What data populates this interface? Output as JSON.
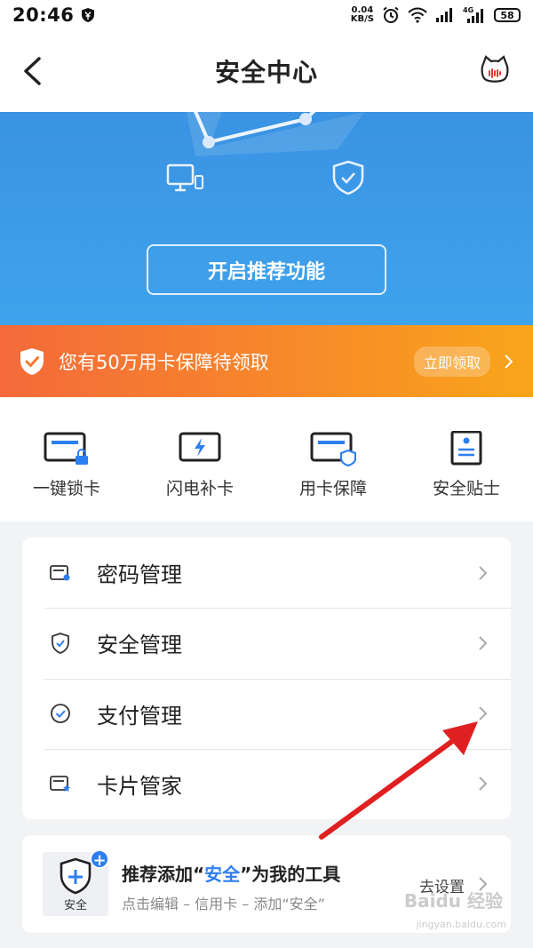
{
  "status_bar": {
    "time": "20:46",
    "net_speed_value": "0.04",
    "net_speed_unit": "KB/S",
    "network": "4G",
    "battery": "58"
  },
  "nav": {
    "title": "安全中心"
  },
  "hero": {
    "cta_label": "开启推荐功能"
  },
  "banner": {
    "text": "您有50万用卡保障待领取",
    "button": "立即领取"
  },
  "quick_actions": [
    {
      "label": "一键锁卡",
      "icon": "card-lock-icon"
    },
    {
      "label": "闪电补卡",
      "icon": "lightning-card-icon"
    },
    {
      "label": "用卡保障",
      "icon": "card-shield-icon"
    },
    {
      "label": "安全贴士",
      "icon": "document-icon"
    }
  ],
  "menu": [
    {
      "label": "密码管理",
      "icon": "password-card-icon"
    },
    {
      "label": "安全管理",
      "icon": "shield-check-icon"
    },
    {
      "label": "支付管理",
      "icon": "check-circle-icon"
    },
    {
      "label": "卡片管家",
      "icon": "card-star-icon"
    }
  ],
  "recommend": {
    "title_prefix": "推荐添加“",
    "title_highlight": "安全",
    "title_suffix": "”为我的工具",
    "subtitle": "点击编辑 – 信用卡 – 添加“安全”",
    "action": "去设置",
    "icon_label": "安全"
  },
  "watermark": {
    "text": "Baidu 经验",
    "sub": "jingyan.baidu.com"
  },
  "colors": {
    "primary_blue": "#2d7ef0",
    "hero_blue": "#3a93e3",
    "banner_orange": "#f7892a",
    "annotation_red": "#e02020"
  }
}
